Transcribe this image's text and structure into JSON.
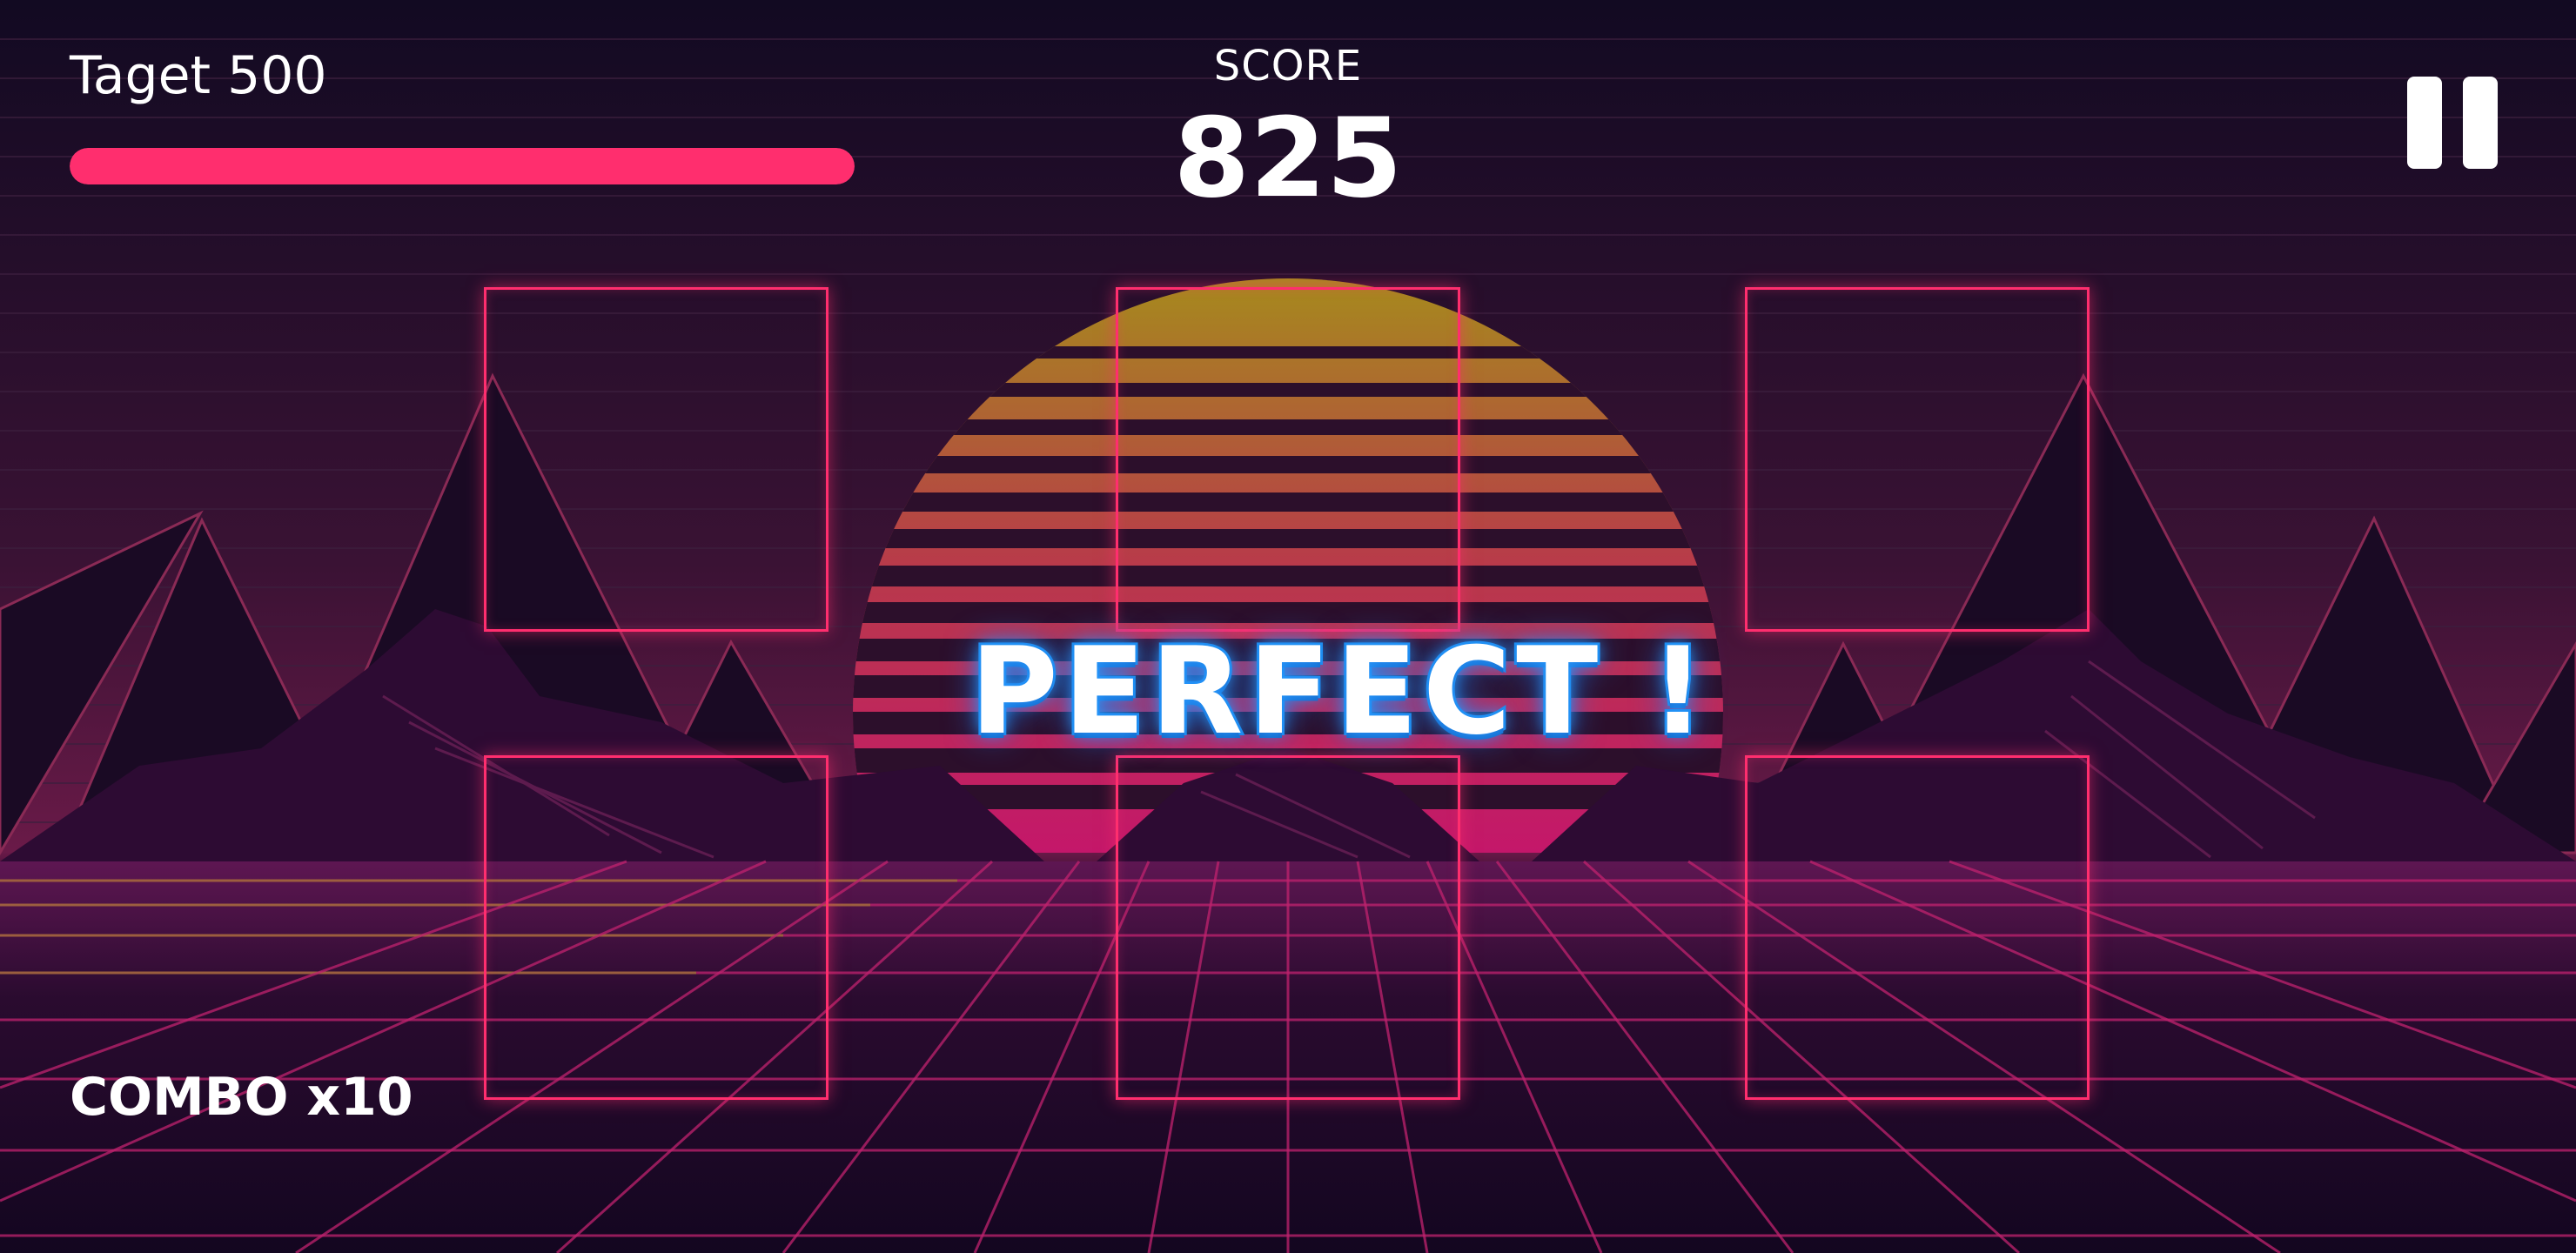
{
  "hud": {
    "target_label": "Taget 500",
    "target_progress": 1.0,
    "score_label": "SCORE",
    "score_value": "825",
    "combo_label": "COMBO x10"
  },
  "feedback_text": "PERFECT !",
  "colors": {
    "accent_pink": "#ff2e6e",
    "feedback_blue": "#1e8ff0",
    "background": "#0d0618"
  },
  "icons": {
    "pause": "pause-icon"
  },
  "pads": [
    {
      "id": "pad-top-left"
    },
    {
      "id": "pad-top-center"
    },
    {
      "id": "pad-top-right"
    },
    {
      "id": "pad-bottom-left"
    },
    {
      "id": "pad-bottom-center"
    },
    {
      "id": "pad-bottom-right"
    }
  ]
}
